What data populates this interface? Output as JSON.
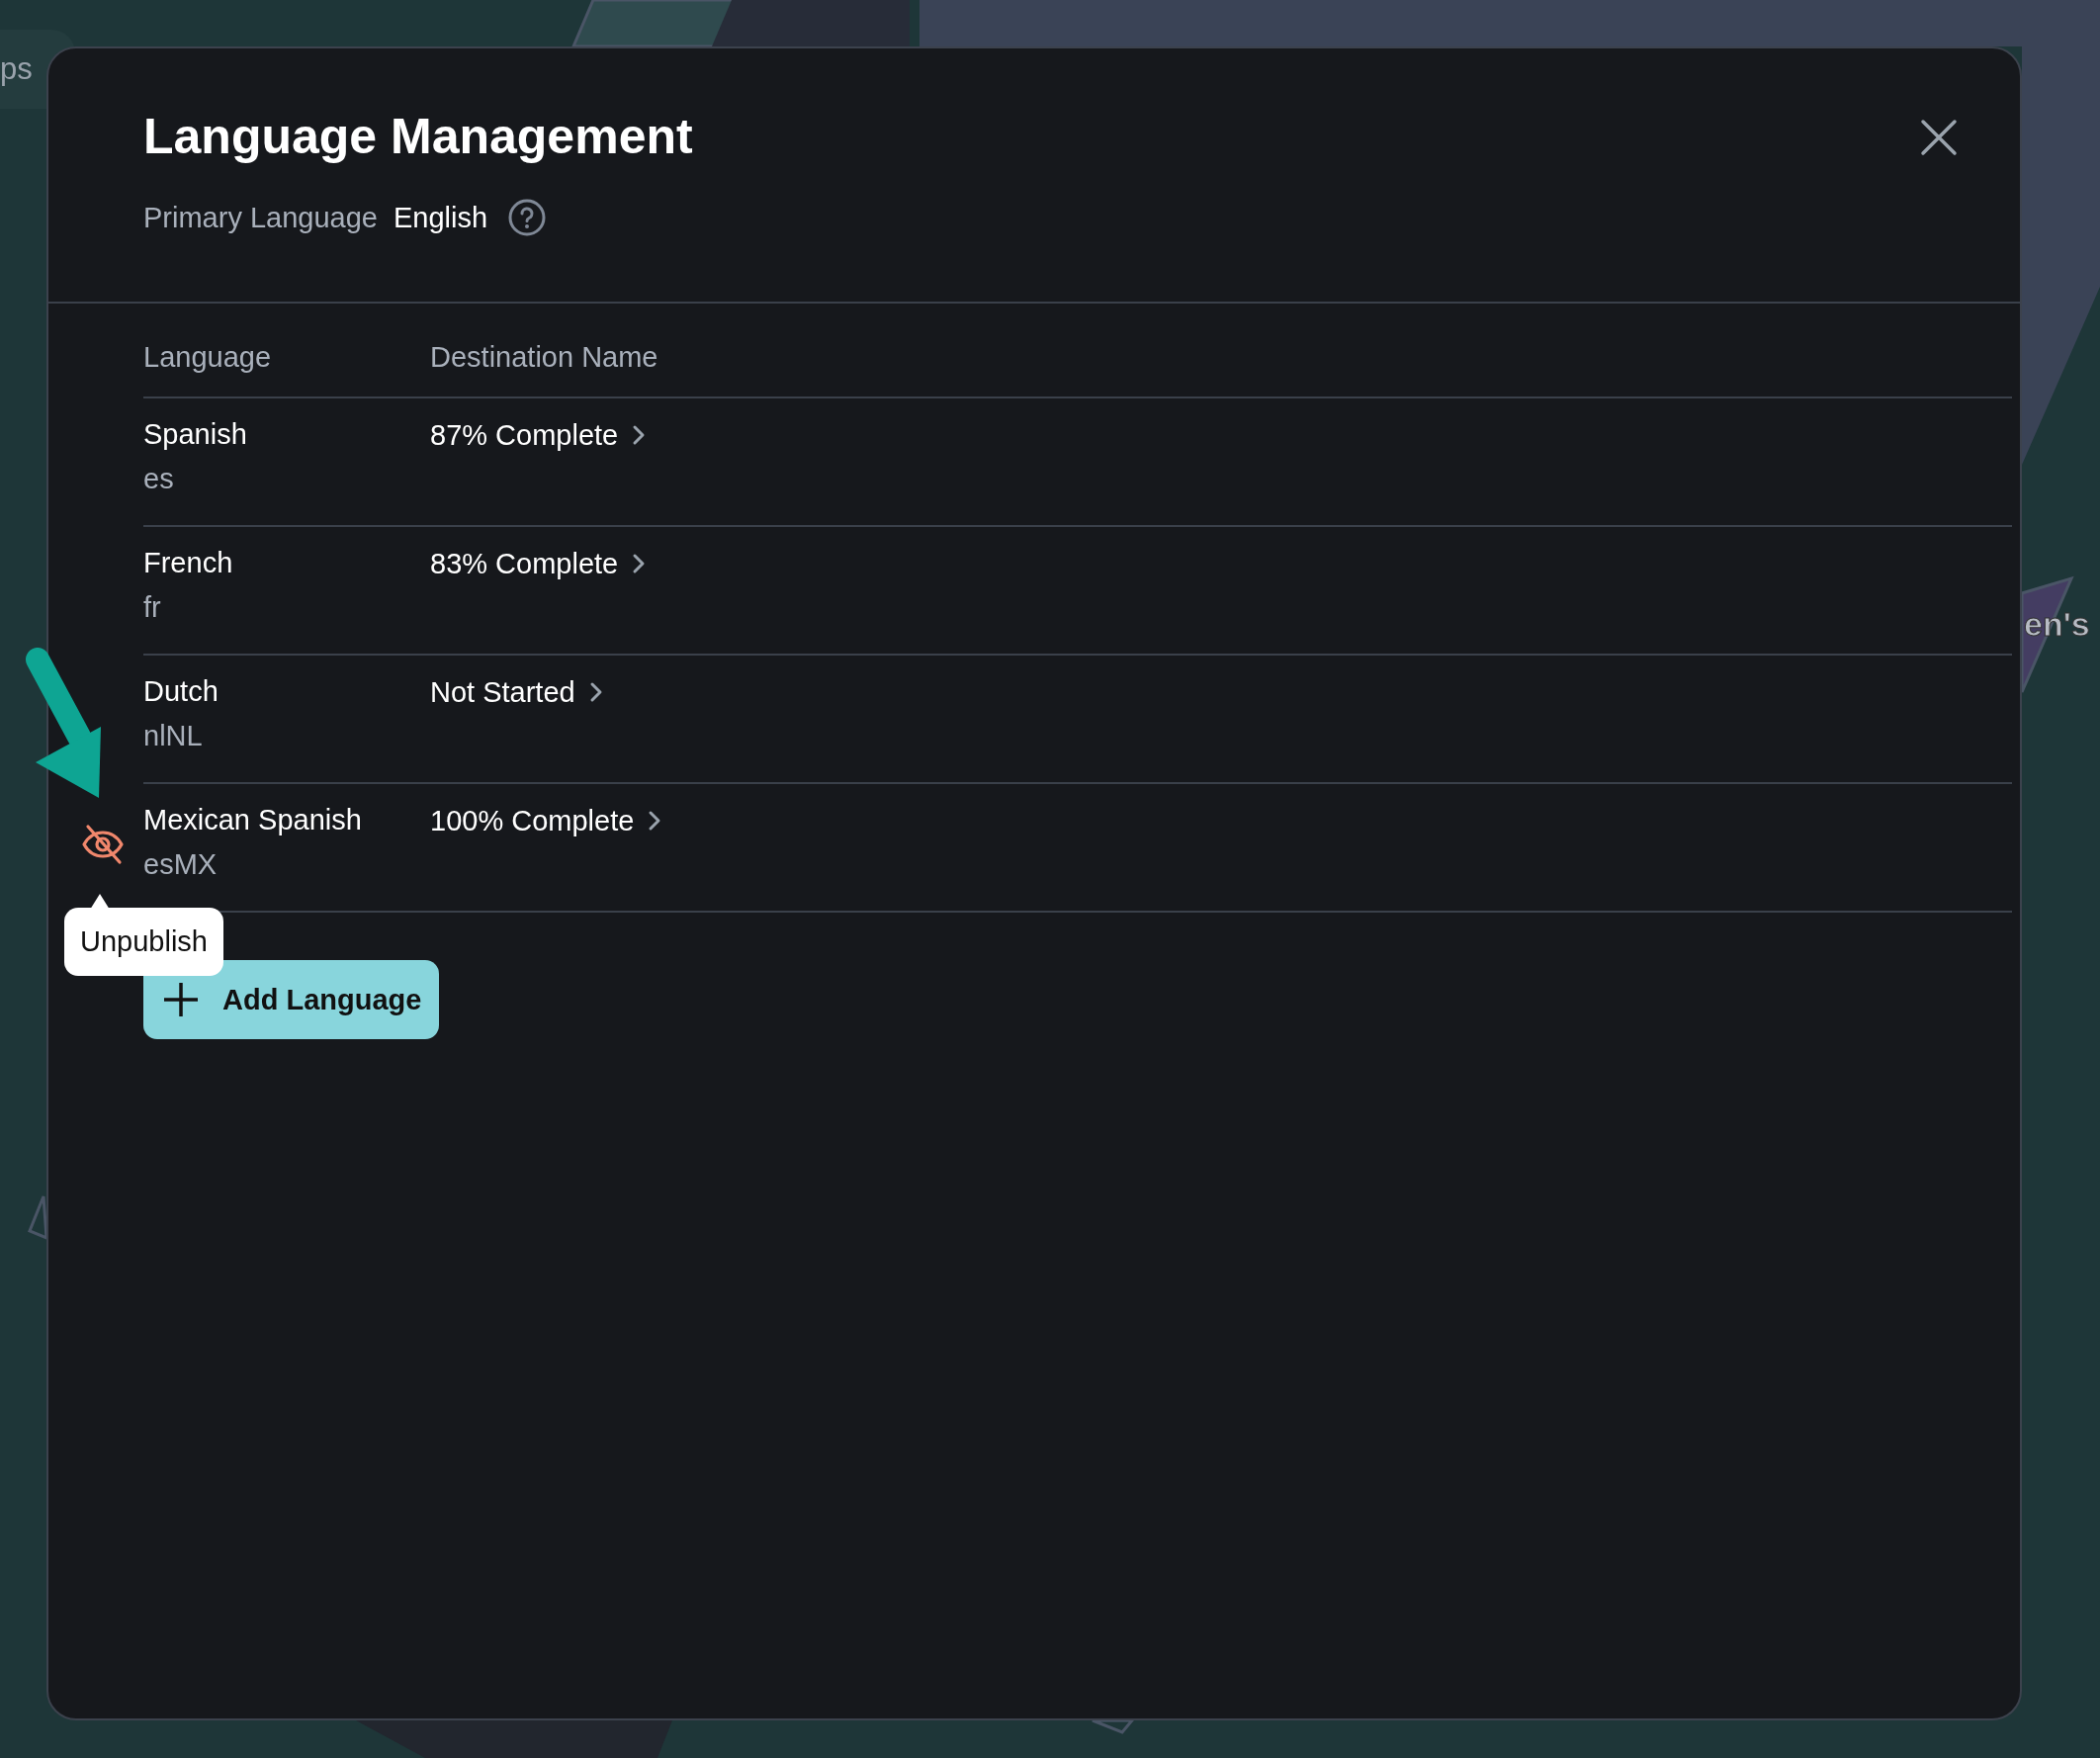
{
  "background": {
    "side_tab": "ps",
    "map_label": "en's"
  },
  "dialog": {
    "title": "Language Management",
    "primary_language": {
      "label": "Primary Language",
      "value": "English"
    }
  },
  "table": {
    "columns": [
      "Language",
      "Destination Name"
    ],
    "rows": [
      {
        "name": "Spanish",
        "code": "es",
        "status": "87% Complete",
        "hovered": false
      },
      {
        "name": "French",
        "code": "fr",
        "status": "83% Complete",
        "hovered": false
      },
      {
        "name": "Dutch",
        "code": "nlNL",
        "status": "Not Started",
        "hovered": false
      },
      {
        "name": "Mexican Spanish",
        "code": "esMX",
        "status": "100% Complete",
        "hovered": true,
        "tooltip": "Unpublish"
      }
    ]
  },
  "add_button": {
    "label": "Add Language"
  }
}
